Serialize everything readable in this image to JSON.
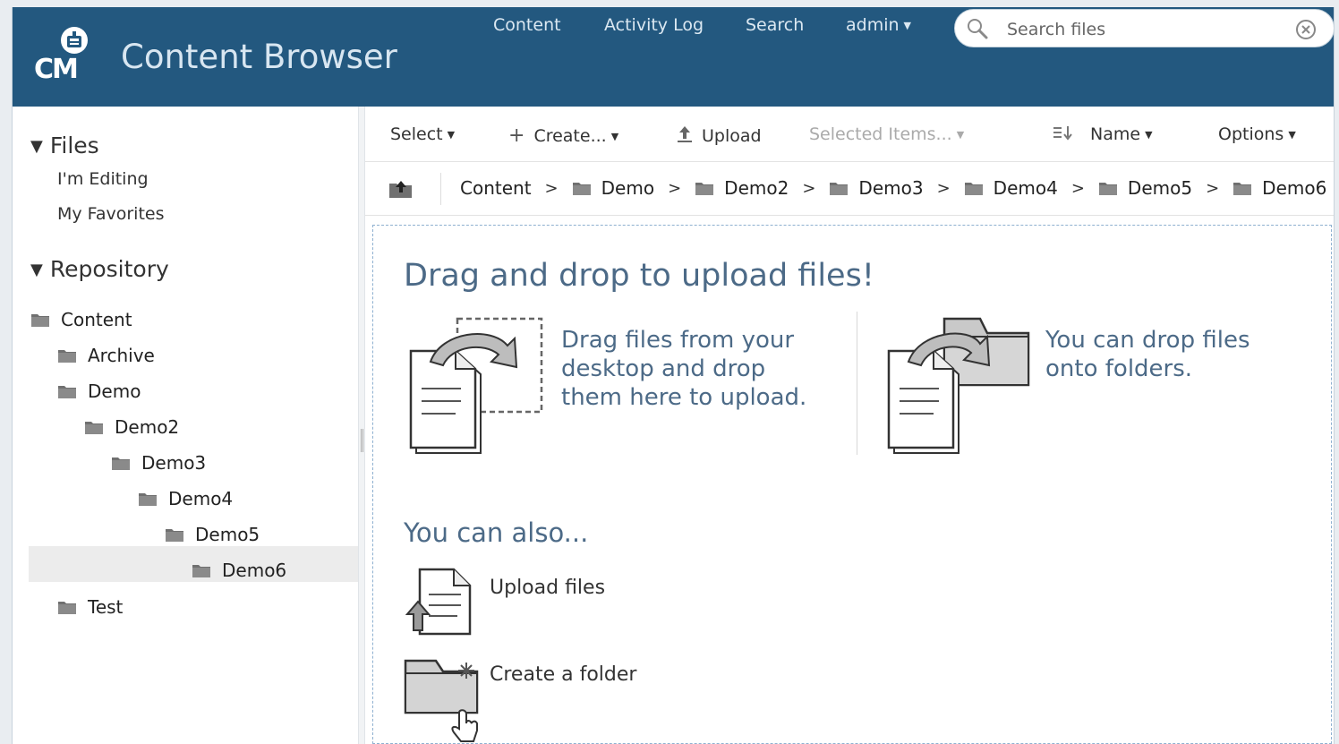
{
  "app": {
    "logo_text": "CM",
    "title": "Content Browser"
  },
  "topnav": {
    "content": "Content",
    "activity_log": "Activity Log",
    "search": "Search",
    "user": "admin"
  },
  "search": {
    "placeholder": "Search files",
    "value": ""
  },
  "sidebar": {
    "files_header": "Files",
    "files_links": [
      "I'm Editing",
      "My Favorites"
    ],
    "repository_header": "Repository",
    "tree": [
      {
        "label": "Content",
        "depth": 0
      },
      {
        "label": "Archive",
        "depth": 1
      },
      {
        "label": "Demo",
        "depth": 1
      },
      {
        "label": "Demo2",
        "depth": 2
      },
      {
        "label": "Demo3",
        "depth": 3
      },
      {
        "label": "Demo4",
        "depth": 4
      },
      {
        "label": "Demo5",
        "depth": 5
      },
      {
        "label": "Demo6",
        "depth": 6,
        "selected": true
      },
      {
        "label": "Test",
        "depth": 1
      }
    ]
  },
  "toolbar": {
    "select": "Select",
    "create": "Create...",
    "upload": "Upload",
    "selected_items": "Selected Items...",
    "sort": "Name",
    "options": "Options"
  },
  "breadcrumb": [
    "Content",
    "Demo",
    "Demo2",
    "Demo3",
    "Demo4",
    "Demo5",
    "Demo6"
  ],
  "dropzone": {
    "title": "Drag and drop to upload files!",
    "drag_text": [
      "Drag files from your",
      "desktop and drop",
      "them here to upload."
    ],
    "folder_text": [
      "You can drop files",
      "onto folders."
    ],
    "also": "You can also...",
    "upload_files": "Upload files",
    "create_folder": "Create a folder"
  },
  "colors": {
    "header_bg": "#23587f",
    "accent_text": "#4c6a87",
    "selection_bg": "#ececec"
  }
}
